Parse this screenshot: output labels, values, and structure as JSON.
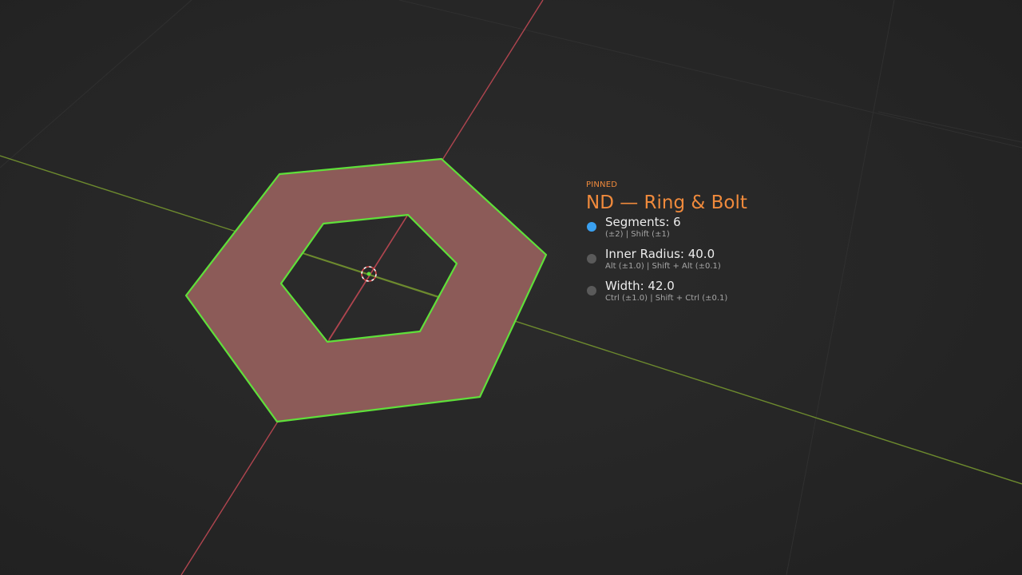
{
  "viewport": {
    "name": "3d-viewport"
  },
  "hud": {
    "status": "PINNED",
    "title": "ND — Ring & Bolt",
    "accent_color": "#f08a3c",
    "items": [
      {
        "label": "Segments: 6",
        "hint": "(±2)  |  Shift (±1)",
        "active": true
      },
      {
        "label": "Inner Radius: 40.0",
        "hint": "Alt (±1.0)  |  Shift + Alt (±0.1)",
        "active": false
      },
      {
        "label": "Width: 42.0",
        "hint": "Ctrl (±1.0)  |  Shift + Ctrl (±0.1)",
        "active": false
      }
    ],
    "active_dot_color": "#3aa0f0",
    "inactive_dot_color": "#5a5a5a"
  },
  "mesh": {
    "face_color": "#8c5b58",
    "outline_color": "#5fe03a"
  },
  "axes": {
    "x_color": "#6d8a2e",
    "y_color": "#b0454f"
  }
}
